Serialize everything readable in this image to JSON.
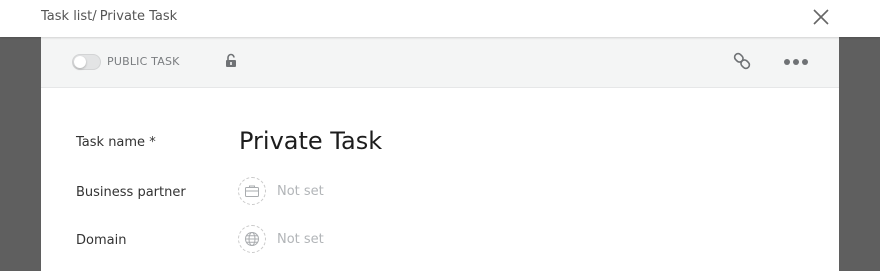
{
  "breadcrumb": {
    "parent": "Task list",
    "separator": "/",
    "current": "Private Task"
  },
  "header": {
    "public_toggle_label": "PUBLIC TASK",
    "public_toggle_on": false
  },
  "fields": {
    "task_name": {
      "label": "Task name *",
      "value": "Private Task"
    },
    "business_partner": {
      "label": "Business partner",
      "value": "Not set",
      "icon": "briefcase-icon"
    },
    "domain": {
      "label": "Domain",
      "value": "Not set",
      "icon": "globe-icon"
    }
  },
  "colors": {
    "backdrop": "#5f5f5f",
    "header_bg": "#f4f5f5",
    "muted_text": "#b2b5b8"
  }
}
